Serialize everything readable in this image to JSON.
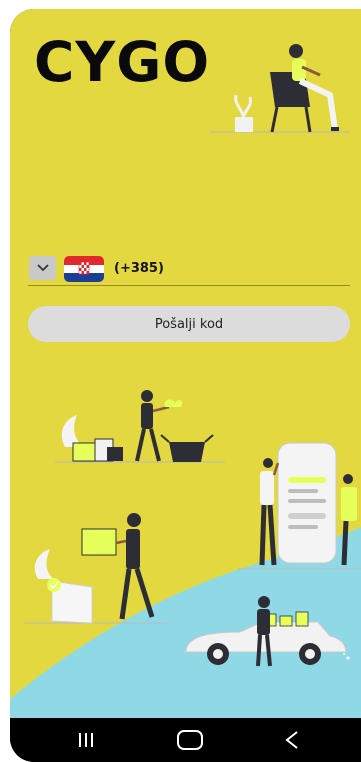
{
  "app": {
    "logo_text": "CYGO"
  },
  "phone_input": {
    "country_code": "(+385)",
    "country_flag": "croatia-flag",
    "dropdown_icon": "chevron-down-icon"
  },
  "actions": {
    "send_code_label": "Pošalji kod"
  },
  "colors": {
    "background": "#e4d840",
    "wave": "#8fd9e6",
    "button": "#dcdcdc",
    "text": "#0a0a0a"
  },
  "navigation_bar": {
    "recent_icon": "recent-apps-icon",
    "home_icon": "home-icon",
    "back_icon": "back-icon"
  }
}
